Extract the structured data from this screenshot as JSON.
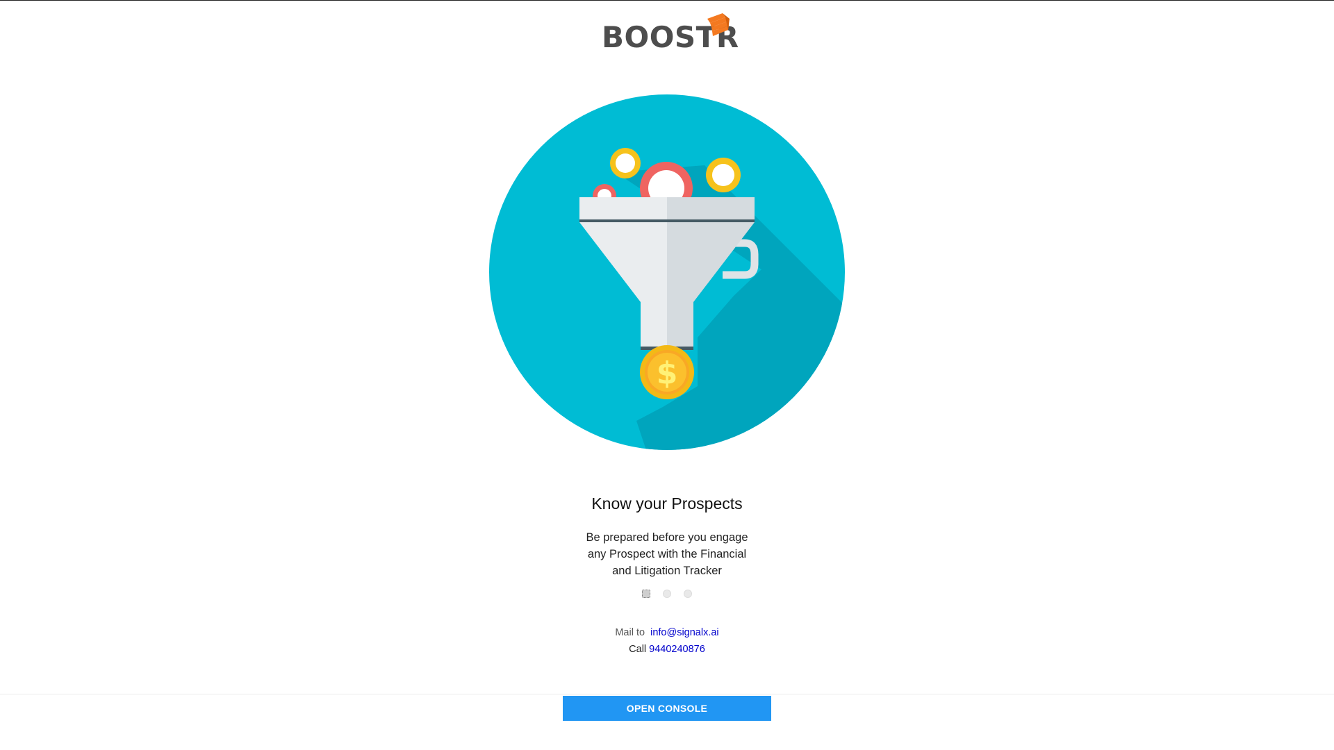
{
  "brand": {
    "name": "BOOSTR",
    "text_color": "#4d4d4d",
    "mark_color": "#f47920"
  },
  "hero": {
    "icon": "funnel-with-coins-icon",
    "circle_color": "#00bcd4"
  },
  "slide": {
    "title": "Know your Prospects",
    "description": "Be prepared before you engage any Prospect with the Financial and Litigation Tracker",
    "total": 3,
    "active_index": 0
  },
  "contact": {
    "mail_label": "Mail to",
    "email": "info@signalx.ai",
    "call_label": "Call",
    "phone": "9440240876"
  },
  "cta": {
    "label": "OPEN CONSOLE",
    "color": "#2196f3"
  }
}
